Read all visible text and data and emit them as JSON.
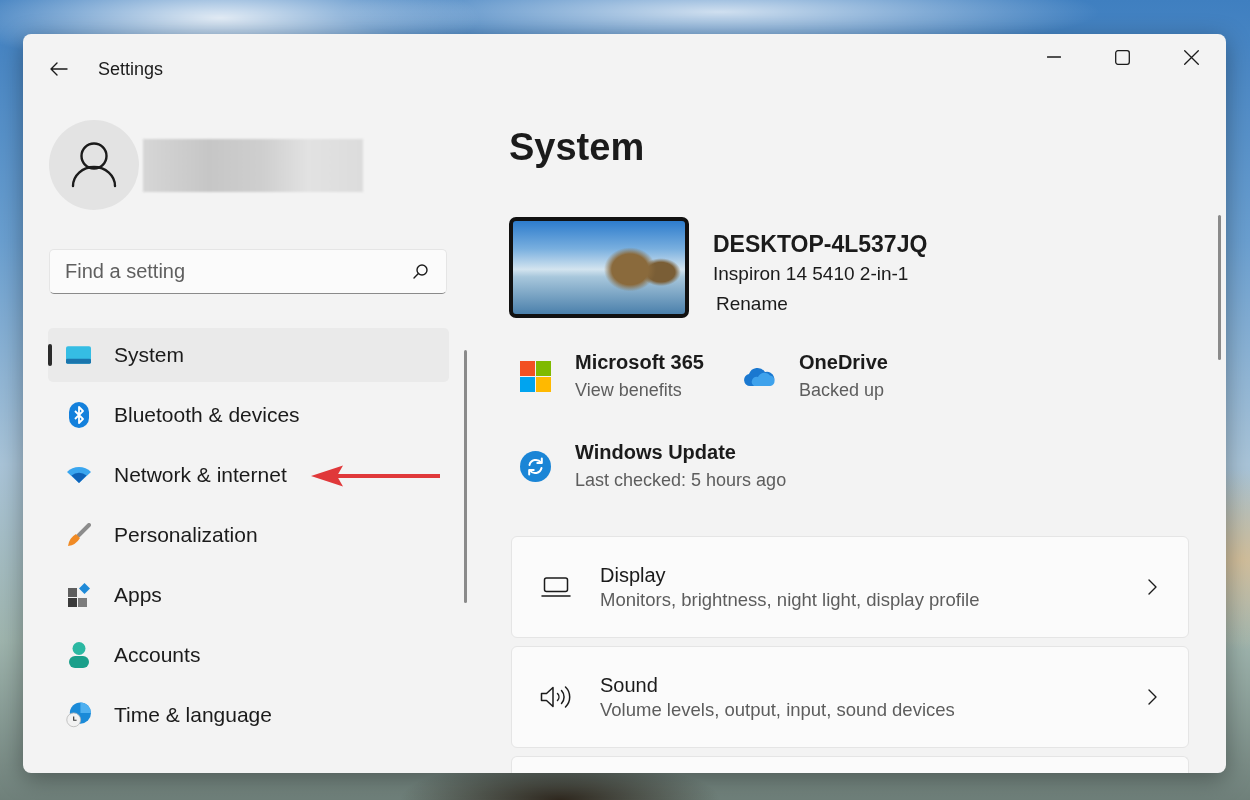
{
  "window": {
    "title": "Settings"
  },
  "search": {
    "placeholder": "Find a setting"
  },
  "sidebar": {
    "items": [
      {
        "label": "System",
        "selected": true
      },
      {
        "label": "Bluetooth & devices",
        "selected": false
      },
      {
        "label": "Network & internet",
        "selected": false
      },
      {
        "label": "Personalization",
        "selected": false
      },
      {
        "label": "Apps",
        "selected": false
      },
      {
        "label": "Accounts",
        "selected": false
      },
      {
        "label": "Time & language",
        "selected": false
      }
    ]
  },
  "page": {
    "title": "System"
  },
  "device": {
    "name": "DESKTOP-4L537JQ",
    "model": "Inspiron 14 5410 2-in-1",
    "rename_link": "Rename"
  },
  "status_tiles": [
    {
      "title": "Microsoft 365",
      "subtitle": "View benefits"
    },
    {
      "title": "OneDrive",
      "subtitle": "Backed up"
    },
    {
      "title": "Windows Update",
      "subtitle": "Last checked: 5 hours ago"
    }
  ],
  "settings_cards": [
    {
      "title": "Display",
      "subtitle": "Monitors, brightness, night light, display profile"
    },
    {
      "title": "Sound",
      "subtitle": "Volume levels, output, input, sound devices"
    }
  ]
}
